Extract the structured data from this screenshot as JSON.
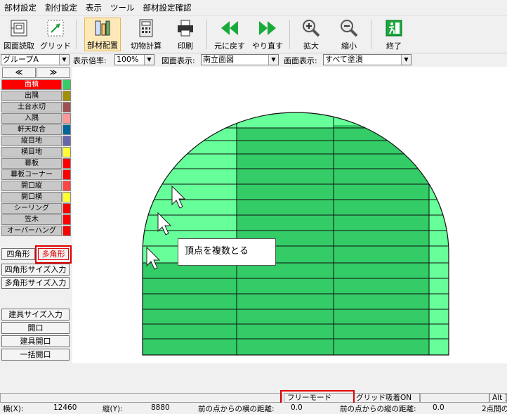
{
  "menu": [
    "部材設定",
    "割付設定",
    "表示",
    "ツール",
    "部材設定確認"
  ],
  "toolbar": {
    "drawing_read": "図面読取",
    "grid": "グリッド",
    "place_member": "部材配置",
    "cut_calc": "切物計算",
    "print": "印刷",
    "undo": "元に戻す",
    "redo": "やり直す",
    "zoom_in": "拡大",
    "zoom_out": "縮小",
    "exit": "終了"
  },
  "options": {
    "group": "グループA",
    "scale_label": "表示倍率:",
    "scale_value": "100%",
    "view_label": "図面表示:",
    "view_value": "南立面図",
    "screen_label": "画面表示:",
    "screen_value": "すべて塗潰"
  },
  "nav": {
    "prev": "≪",
    "next": "≫"
  },
  "members": [
    {
      "name": "面積",
      "color": "#33cc66",
      "selected": true
    },
    {
      "name": "出隅",
      "color": "#a09000"
    },
    {
      "name": "土台水切",
      "color": "#a05050"
    },
    {
      "name": "入隅",
      "color": "#ff9999"
    },
    {
      "name": "軒天取合",
      "color": "#006699"
    },
    {
      "name": "縦目地",
      "color": "#6666aa"
    },
    {
      "name": "横目地",
      "color": "#ffff33"
    },
    {
      "name": "幕板",
      "color": "#ff0000"
    },
    {
      "name": "幕板コーナー",
      "color": "#ff0000"
    },
    {
      "name": "開口縦",
      "color": "#ff4444"
    },
    {
      "name": "開口横",
      "color": "#ffff33"
    },
    {
      "name": "シーリング",
      "color": "#ff0000"
    },
    {
      "name": "笠木",
      "color": "#ff0000"
    },
    {
      "name": "オーバーハング",
      "color": "#ff0000"
    }
  ],
  "shape_buttons": {
    "rect": "四角形",
    "polygon": "多角形",
    "rect_size": "四角形サイズ入力",
    "polygon_size": "多角形サイズ入力",
    "fitting_size": "建具サイズ入力",
    "opening": "開口",
    "fitting_opening": "建具開口",
    "bulk_opening": "一括開口"
  },
  "tooltip": "頂点を複数とる",
  "status": {
    "mode": "フリーモード",
    "grid_snap": "グリッド吸着ON",
    "alt": "Alt ]"
  },
  "coords": {
    "x_label": "横(X):",
    "x_value": "12460",
    "y_label": "縦(Y):",
    "y_value": "8880",
    "prev_h_label": "前の点からの横の距離:",
    "prev_h_value": "0.0",
    "prev_v_label": "前の点からの縦の距離:",
    "prev_v_value": "0.0",
    "two_point_label": "2点間の"
  }
}
